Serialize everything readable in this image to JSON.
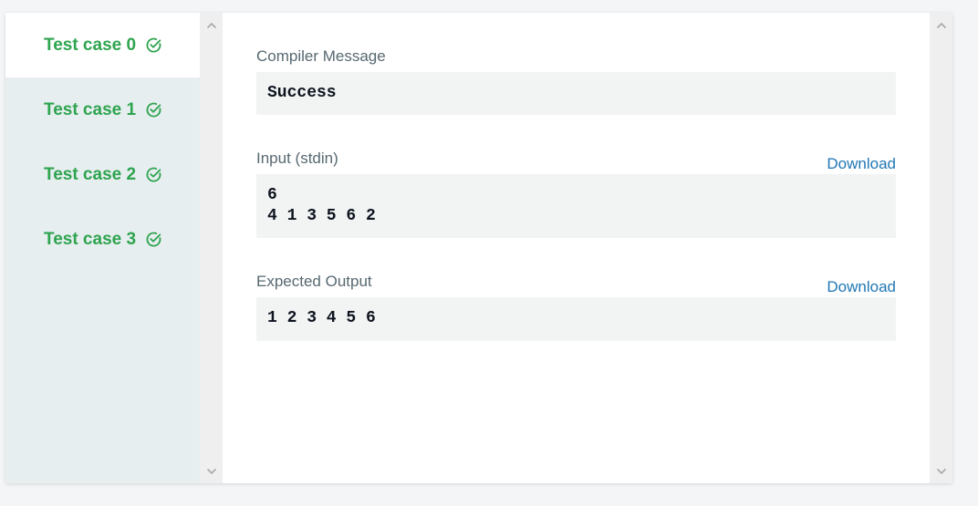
{
  "test_cases": [
    {
      "label": "Test case 0",
      "status_icon": "check-circle-icon",
      "active": true
    },
    {
      "label": "Test case 1",
      "status_icon": "check-circle-icon",
      "active": false
    },
    {
      "label": "Test case 2",
      "status_icon": "check-circle-icon",
      "active": false
    },
    {
      "label": "Test case 3",
      "status_icon": "check-circle-icon",
      "active": false
    }
  ],
  "compiler": {
    "label": "Compiler Message",
    "value": "Success"
  },
  "input": {
    "label": "Input (stdin)",
    "download": "Download",
    "lines": [
      "6",
      "4 1 3 5 6 2"
    ]
  },
  "expected": {
    "label": "Expected Output",
    "download": "Download",
    "lines": [
      "1 2 3 4 5 6"
    ]
  },
  "colors": {
    "success": "#2ea44f",
    "link": "#1f77b4",
    "sidebar_bg": "#e7eef0",
    "code_bg": "#f2f4f4"
  }
}
